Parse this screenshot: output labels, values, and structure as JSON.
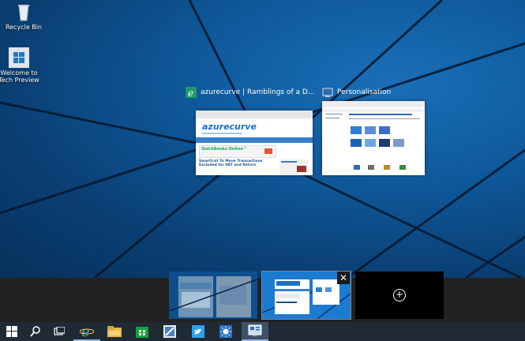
{
  "desktop": {
    "icons": [
      {
        "label": "Recycle Bin",
        "icon": "recycle-bin-icon"
      },
      {
        "label": "Welcome to Tech Preview",
        "icon": "windows-logo-icon"
      }
    ]
  },
  "task_view": {
    "windows": [
      {
        "title": "azurecurve | Ramblings of a D...",
        "app": "internet-explorer-icon"
      },
      {
        "title": "Personalisation",
        "app": "personalisation-icon"
      }
    ],
    "thumbnail_texts": {
      "site_logo": "azurecurve",
      "ad_title": "QuickBooks Online™",
      "article_title": "SmartList To Move Transactions Excluded for VAT and Return"
    },
    "desktops": [
      {
        "name": "desktop-1"
      },
      {
        "name": "desktop-2",
        "selected": true
      }
    ],
    "close_label": "✕",
    "add_label": "+"
  },
  "taskbar": {
    "items": [
      {
        "icon": "start-icon"
      },
      {
        "icon": "search-icon"
      },
      {
        "icon": "task-view-icon"
      },
      {
        "icon": "internet-explorer-icon",
        "state": "running"
      },
      {
        "icon": "file-explorer-icon"
      },
      {
        "icon": "store-icon"
      },
      {
        "icon": "paint-icon"
      },
      {
        "icon": "twitter-icon"
      },
      {
        "icon": "settings-sun-icon"
      },
      {
        "icon": "control-panel-icon",
        "state": "active"
      }
    ]
  },
  "colors": {
    "accent": "#1f6fbf",
    "taskbar": "#1f2a35",
    "vd_bar": "#222222"
  }
}
